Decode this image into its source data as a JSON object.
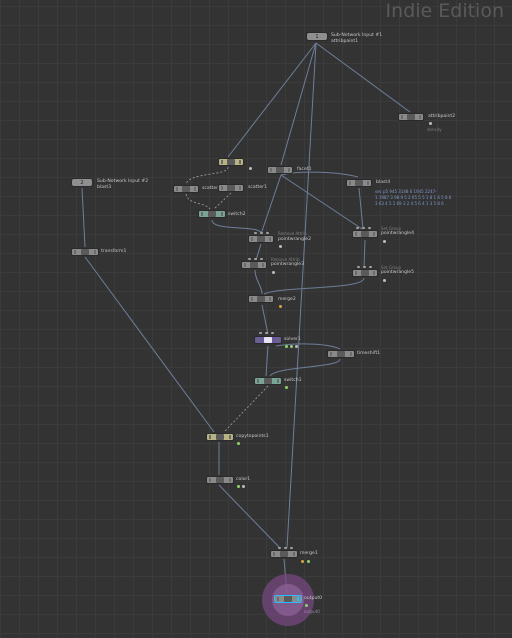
{
  "app": {
    "edition": "Indie Edition"
  },
  "colors": {
    "wire": "#6d7f9a",
    "wire_dashed": "#9aa4b2",
    "accent_output": "#2bb9ff"
  },
  "nodes": {
    "subin1": {
      "badge": "1",
      "label": "Sub-Network Input #1",
      "sub": "attribpaint1"
    },
    "subin2": {
      "badge": "2",
      "label": "Sub-Network Input #2",
      "sub": "blast3"
    },
    "attribpaint2": {
      "label": "attribpaint2",
      "sub": "density"
    },
    "facet1": {
      "label": "facet1"
    },
    "blast4": {
      "label": "blast4",
      "info": [
        "sec p5 945 3148 6 1945 2247-",
        "1 1987 3 98 9 5 2 65 5 5 1 8 1 6 5 8 6",
        "3 63 4 5 1 69 3 2 4 5 6 4 1 3 5 8 6"
      ]
    },
    "scatter1": {
      "label": "scatter1"
    },
    "scatter2": {
      "label": "scatter2"
    },
    "switch2": {
      "label": "switch2"
    },
    "transform1": {
      "label": "transform1"
    },
    "pointwrangle2": {
      "label": "pointwrangle2",
      "sub": "Remove Attrib"
    },
    "pointwrangle3": {
      "label": "pointwrangle3",
      "sub": "Remove Attrib"
    },
    "pointwrangle4": {
      "label": "pointwrangle4",
      "sub": "Set Group"
    },
    "pointwrangle5": {
      "label": "pointwrangle5",
      "sub": "Set Group"
    },
    "merge2": {
      "label": "merge2"
    },
    "solver1": {
      "label": "solver1"
    },
    "timeshift1": {
      "label": "timeshift1"
    },
    "switch1": {
      "label": "switch1"
    },
    "copytopoints1": {
      "label": "copytopoints1"
    },
    "color1": {
      "label": "color1"
    },
    "merge1": {
      "label": "merge1"
    },
    "output0": {
      "label": "output0",
      "sub": "output0"
    }
  }
}
